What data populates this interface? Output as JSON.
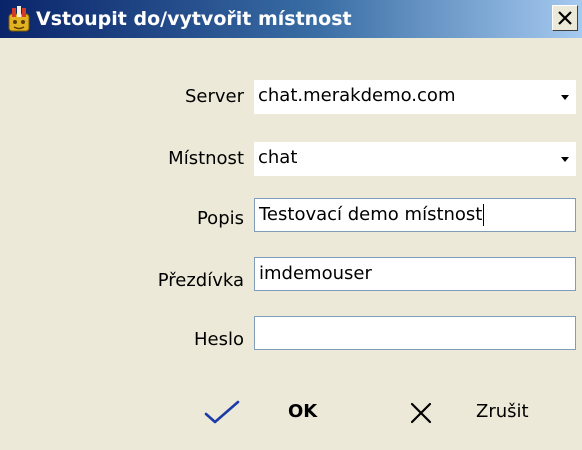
{
  "window": {
    "title": "Vstoupit do/vytvořit místnost"
  },
  "icons": {
    "app": "app-icon",
    "close": "close-icon",
    "dropdown": "chevron-down-icon",
    "ok": "checkmark-icon",
    "cancel": "x-icon"
  },
  "fields": {
    "server": {
      "label": "Server",
      "value": "chat.merakdemo.com"
    },
    "room": {
      "label": "Místnost",
      "value": "chat"
    },
    "description": {
      "label": "Popis",
      "value": "Testovací demo místnost"
    },
    "nickname": {
      "label": "Přezdívka",
      "value": "imdemouser"
    },
    "password": {
      "label": "Heslo",
      "value": ""
    }
  },
  "buttons": {
    "ok_label": "OK",
    "cancel_label": "Zrušit"
  }
}
